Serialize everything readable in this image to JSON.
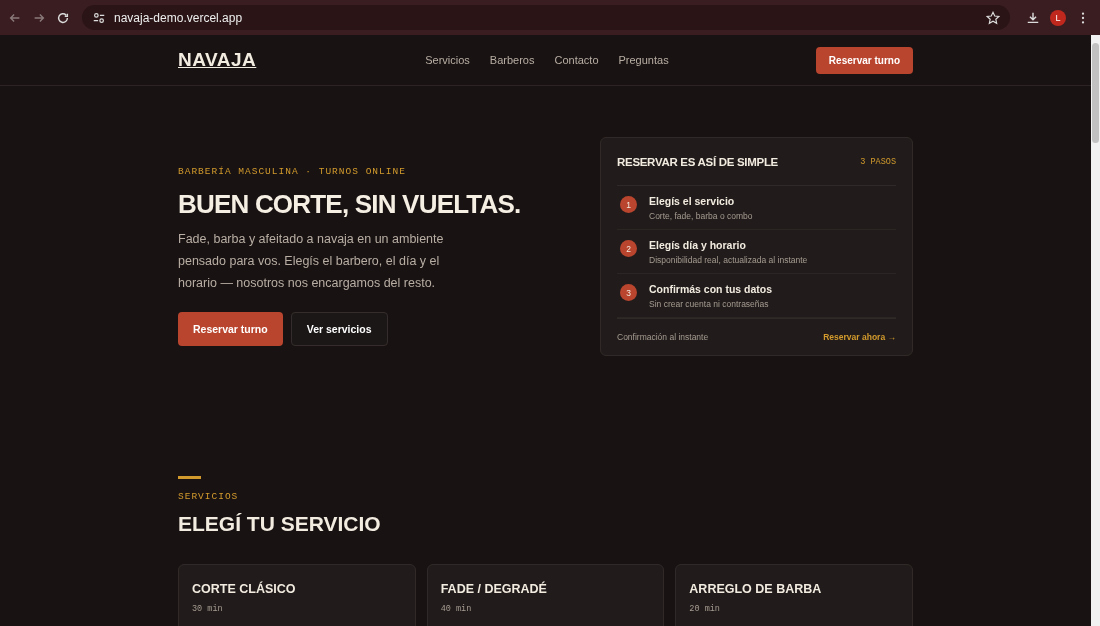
{
  "browser": {
    "url": "navaja-demo.vercel.app",
    "profile_initial": "L"
  },
  "nav": {
    "logo": "NAVAJA",
    "links": [
      "Servicios",
      "Barberos",
      "Contacto",
      "Preguntas"
    ],
    "cta": "Reservar turno"
  },
  "hero": {
    "eyebrow": "BARBERÍA MASCULINA · TURNOS ONLINE",
    "title": "BUEN CORTE, SIN VUELTAS.",
    "text": "Fade, barba y afeitado a navaja en un ambiente pensado para vos. Elegís el barbero, el día y el horario — nosotros nos encargamos del resto.",
    "buttons": [
      {
        "label": "Reservar turno",
        "kind": "primary"
      },
      {
        "label": "Ver servicios",
        "kind": "secondary"
      }
    ]
  },
  "steps_card": {
    "title": "RESERVAR ES ASÍ DE SIMPLE",
    "badge": "3 PASOS",
    "steps": [
      {
        "number": "1",
        "title": "Elegís el servicio",
        "text": "Corte, fade, barba o combo"
      },
      {
        "number": "2",
        "title": "Elegís día y horario",
        "text": "Disponibilidad real, actualizada al instante"
      },
      {
        "number": "3",
        "title": "Confirmás con tus datos",
        "text": "Sin crear cuenta ni contraseñas"
      }
    ],
    "footer_text": "Confirmación al instante",
    "footer_link": "Reservar ahora →"
  },
  "services": {
    "eyebrow": "SERVICIOS",
    "title": "ELEGÍ TU SERVICIO",
    "items": [
      {
        "name": "CORTE CLÁSICO",
        "duration": "30 min"
      },
      {
        "name": "FADE / DEGRADÉ",
        "duration": "40 min"
      },
      {
        "name": "ARREGLO DE BARBA",
        "duration": "20 min"
      }
    ]
  }
}
